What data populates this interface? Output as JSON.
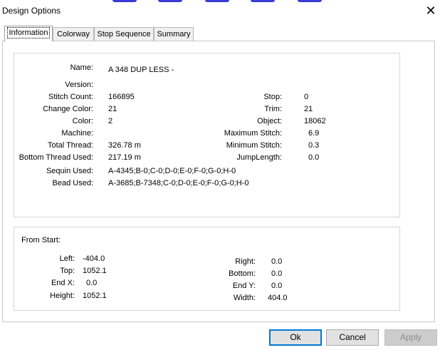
{
  "window": {
    "title": "Design Options",
    "close_label": "✕"
  },
  "tabs": [
    {
      "label": "Information"
    },
    {
      "label": "Colorway"
    },
    {
      "label": "Stop Sequence"
    },
    {
      "label": "Summary"
    }
  ],
  "info": {
    "name_label": "Name:",
    "name_value": "A 348 DUP LESS -",
    "version_label": "Version:",
    "stitch_count_label": "Stitch Count:",
    "stitch_count_value": "166895",
    "change_color_label": "Change Color:",
    "change_color_value": "21",
    "color_label": "Color:",
    "color_value": "2",
    "machine_label": "Machine:",
    "total_thread_label": "Total Thread:",
    "total_thread_value": "326.78 m",
    "bottom_thread_label": "Bottom Thread Used:",
    "bottom_thread_value": "217.19 m",
    "sequin_label": "Sequin Used:",
    "sequin_value": "A-4345;B-0;C-0;D-0;E-0;F-0;G-0;H-0",
    "bead_label": "Bead Used:",
    "bead_value": "A-3685;B-7348;C-0;D-0;E-0;F-0;G-0;H-0",
    "stop_label": "Stop:",
    "stop_value": "0",
    "trim_label": "Trim:",
    "trim_value": "21",
    "object_label": "Object:",
    "object_value": "18062",
    "max_stitch_label": "Maximum Stitch:",
    "max_stitch_value": "6.9",
    "min_stitch_label": "Minimum Stitch:",
    "min_stitch_value": "0.3",
    "jump_length_label": "JumpLength:",
    "jump_length_value": "0.0"
  },
  "start": {
    "heading": "From Start:",
    "left_label": "Left:",
    "left_value": "-404.0",
    "top_label": "Top:",
    "top_value": "1052.1",
    "endx_label": "End X:",
    "endx_value": "0.0",
    "height_label": "Height:",
    "height_value": "1052.1",
    "right_label": "Right:",
    "right_value": "0.0",
    "bottom_label": "Bottom:",
    "bottom_value": "0.0",
    "endy_label": "End Y:",
    "endy_value": "0.0",
    "width_label": "Width:",
    "width_value": "404.0"
  },
  "buttons": {
    "ok": "Ok",
    "cancel": "Cancel",
    "apply": "Apply"
  },
  "colors": {
    "accent": "#0078d7",
    "border": "#d6d6d6"
  }
}
